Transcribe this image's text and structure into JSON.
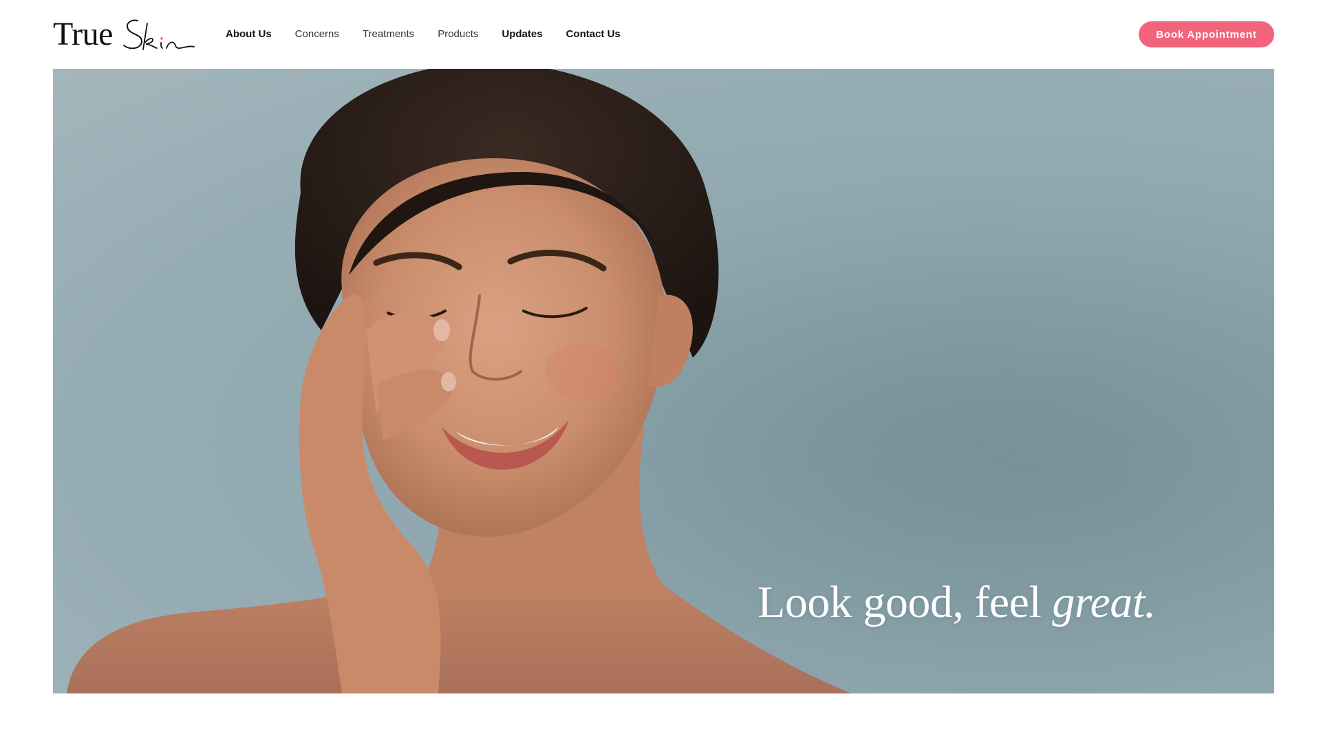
{
  "brand": {
    "logo_word1": "True",
    "logo_word2": "Skin",
    "accent_color": "#f2647e"
  },
  "nav": {
    "items": [
      {
        "label": "About Us"
      },
      {
        "label": "Concerns"
      },
      {
        "label": "Treatments"
      },
      {
        "label": "Products"
      },
      {
        "label": "Updates"
      },
      {
        "label": "Contact Us"
      }
    ]
  },
  "header": {
    "cta_label": "Book Appointment"
  },
  "hero": {
    "tagline_main": "Look good, feel ",
    "tagline_emphasis": "great.",
    "image_subject": "smiling-woman-portrait"
  }
}
